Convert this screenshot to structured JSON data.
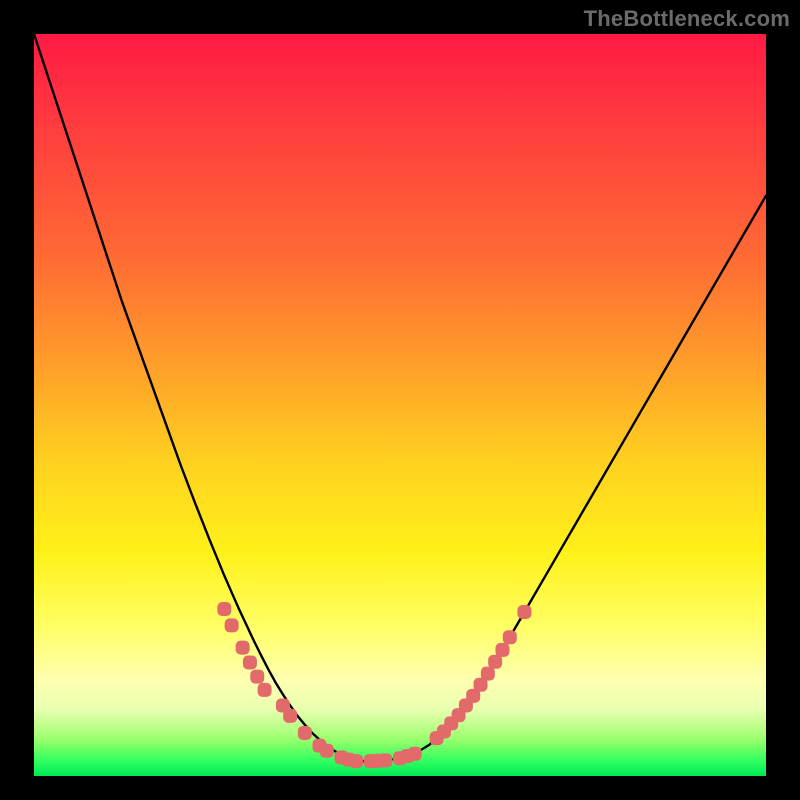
{
  "watermark": "TheBottleneck.com",
  "colors": {
    "frame": "#000000",
    "curve": "#000000",
    "markers": "#e26a6a",
    "gradient_stops": [
      "#ff1a44",
      "#ff3b3f",
      "#ff6a34",
      "#ffa02a",
      "#ffd21f",
      "#fff11a",
      "#ffff66",
      "#ffffb0",
      "#e9ffb0",
      "#9cff6e",
      "#2fff5e",
      "#00e85a"
    ]
  },
  "chart_data": {
    "type": "line",
    "title": "",
    "xlabel": "",
    "ylabel": "",
    "xlim": [
      0,
      100
    ],
    "ylim": [
      0,
      100
    ],
    "x": [
      0,
      2,
      4,
      6,
      8,
      10,
      12,
      14,
      16,
      18,
      20,
      22,
      24,
      26,
      28,
      30,
      31,
      32,
      33,
      34,
      35,
      36,
      37,
      38,
      39,
      40,
      41,
      42,
      43,
      44,
      45,
      46,
      48,
      50,
      52,
      54,
      56,
      58,
      60,
      62,
      64,
      66,
      68,
      70,
      72,
      74,
      76,
      78,
      80,
      82,
      84,
      86,
      88,
      90,
      92,
      94,
      96,
      98,
      100
    ],
    "values": [
      100,
      94,
      88,
      82,
      76,
      70,
      64,
      58.5,
      53,
      47.5,
      42,
      36.8,
      31.8,
      27,
      22.5,
      18.3,
      16.3,
      14.4,
      12.6,
      11,
      9.5,
      8.1,
      6.9,
      5.8,
      4.9,
      4.1,
      3.4,
      2.9,
      2.5,
      2.2,
      2,
      2,
      2.1,
      2.4,
      3,
      4.2,
      6,
      8.2,
      10.8,
      13.8,
      17,
      20.4,
      23.8,
      27.2,
      30.6,
      34,
      37.4,
      40.8,
      44.2,
      47.6,
      51,
      54.4,
      57.8,
      61.2,
      64.6,
      68,
      71.4,
      74.8,
      78.2
    ],
    "markers": [
      {
        "x": 26,
        "y": 22.5
      },
      {
        "x": 27,
        "y": 20.3
      },
      {
        "x": 28.5,
        "y": 17.3
      },
      {
        "x": 29.5,
        "y": 15.3
      },
      {
        "x": 30.5,
        "y": 13.4
      },
      {
        "x": 31.5,
        "y": 11.6
      },
      {
        "x": 34,
        "y": 9.5
      },
      {
        "x": 35,
        "y": 8.1
      },
      {
        "x": 37,
        "y": 5.8
      },
      {
        "x": 39,
        "y": 4.1
      },
      {
        "x": 40,
        "y": 3.4
      },
      {
        "x": 42,
        "y": 2.5
      },
      {
        "x": 43,
        "y": 2.2
      },
      {
        "x": 44,
        "y": 2.0
      },
      {
        "x": 46,
        "y": 2.0
      },
      {
        "x": 47,
        "y": 2.05
      },
      {
        "x": 48,
        "y": 2.1
      },
      {
        "x": 50,
        "y": 2.4
      },
      {
        "x": 51,
        "y": 2.7
      },
      {
        "x": 52,
        "y": 3.0
      },
      {
        "x": 55,
        "y": 5.1
      },
      {
        "x": 56,
        "y": 6.0
      },
      {
        "x": 57,
        "y": 7.1
      },
      {
        "x": 58,
        "y": 8.2
      },
      {
        "x": 59,
        "y": 9.5
      },
      {
        "x": 60,
        "y": 10.8
      },
      {
        "x": 61,
        "y": 12.3
      },
      {
        "x": 62,
        "y": 13.8
      },
      {
        "x": 63,
        "y": 15.4
      },
      {
        "x": 64,
        "y": 17.0
      },
      {
        "x": 65,
        "y": 18.7
      },
      {
        "x": 67,
        "y": 22.1
      }
    ]
  }
}
